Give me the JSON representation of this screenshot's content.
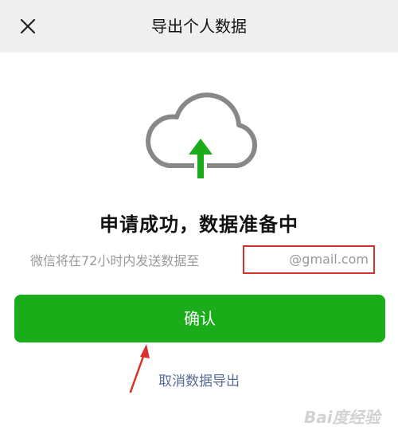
{
  "header": {
    "title": "导出个人数据",
    "close_icon": "close-icon"
  },
  "status": {
    "title": "申请成功，数据准备中",
    "send_text": "微信将在72小时内发送数据至",
    "email": "@gmail.com",
    "icon": "cloud-upload-icon"
  },
  "actions": {
    "confirm_label": "确认",
    "cancel_label": "取消数据导出"
  },
  "watermark": {
    "text": "Bai度经验"
  },
  "colors": {
    "primary_green": "#1aad19",
    "link_blue": "#576b95",
    "highlight_red": "#d8302b",
    "icon_gray": "#888888"
  }
}
